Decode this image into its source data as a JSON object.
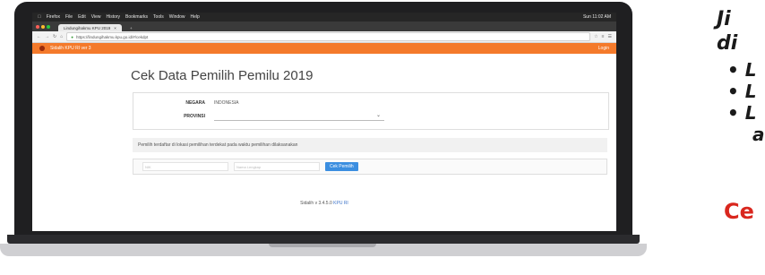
{
  "mac_menubar": [
    "Firefox",
    "File",
    "Edit",
    "View",
    "History",
    "Bookmarks",
    "Tools",
    "Window",
    "Help"
  ],
  "browser": {
    "tab_title": "Lindungihakmu KPU 2019",
    "url": "https://lindungihakmu.kpu.go.id/#/cekdpt",
    "status_right": "Sun 11:02 AM"
  },
  "app": {
    "title": "Sidalih KPU RI ver 3",
    "login_label": "Login"
  },
  "page": {
    "heading": "Cek Data Pemilih Pemilu 2019",
    "negara_label": "NEGARA",
    "negara_value": "INDONESIA",
    "provinsi_label": "PROVINSI",
    "info_text": "Pemilih terdaftar di lokasi pemilihan terdekat pada waktu pemilihan dilaksanakan",
    "search_placeholder_1": "NIK",
    "search_placeholder_2": "Nama Lengkap",
    "check_button": "Cek Pemilih",
    "footer_version": "Sidalih v 3.4.5.0",
    "footer_link": "KPU RI"
  },
  "side_banner": {
    "line1": "Ji",
    "line2": "di",
    "bullets": [
      "• L",
      "• L",
      "• L",
      "a"
    ],
    "cta": "Ce"
  },
  "colors": {
    "accent": "#f47a2b",
    "button": "#3b8ee0",
    "cta": "#d9271e"
  }
}
